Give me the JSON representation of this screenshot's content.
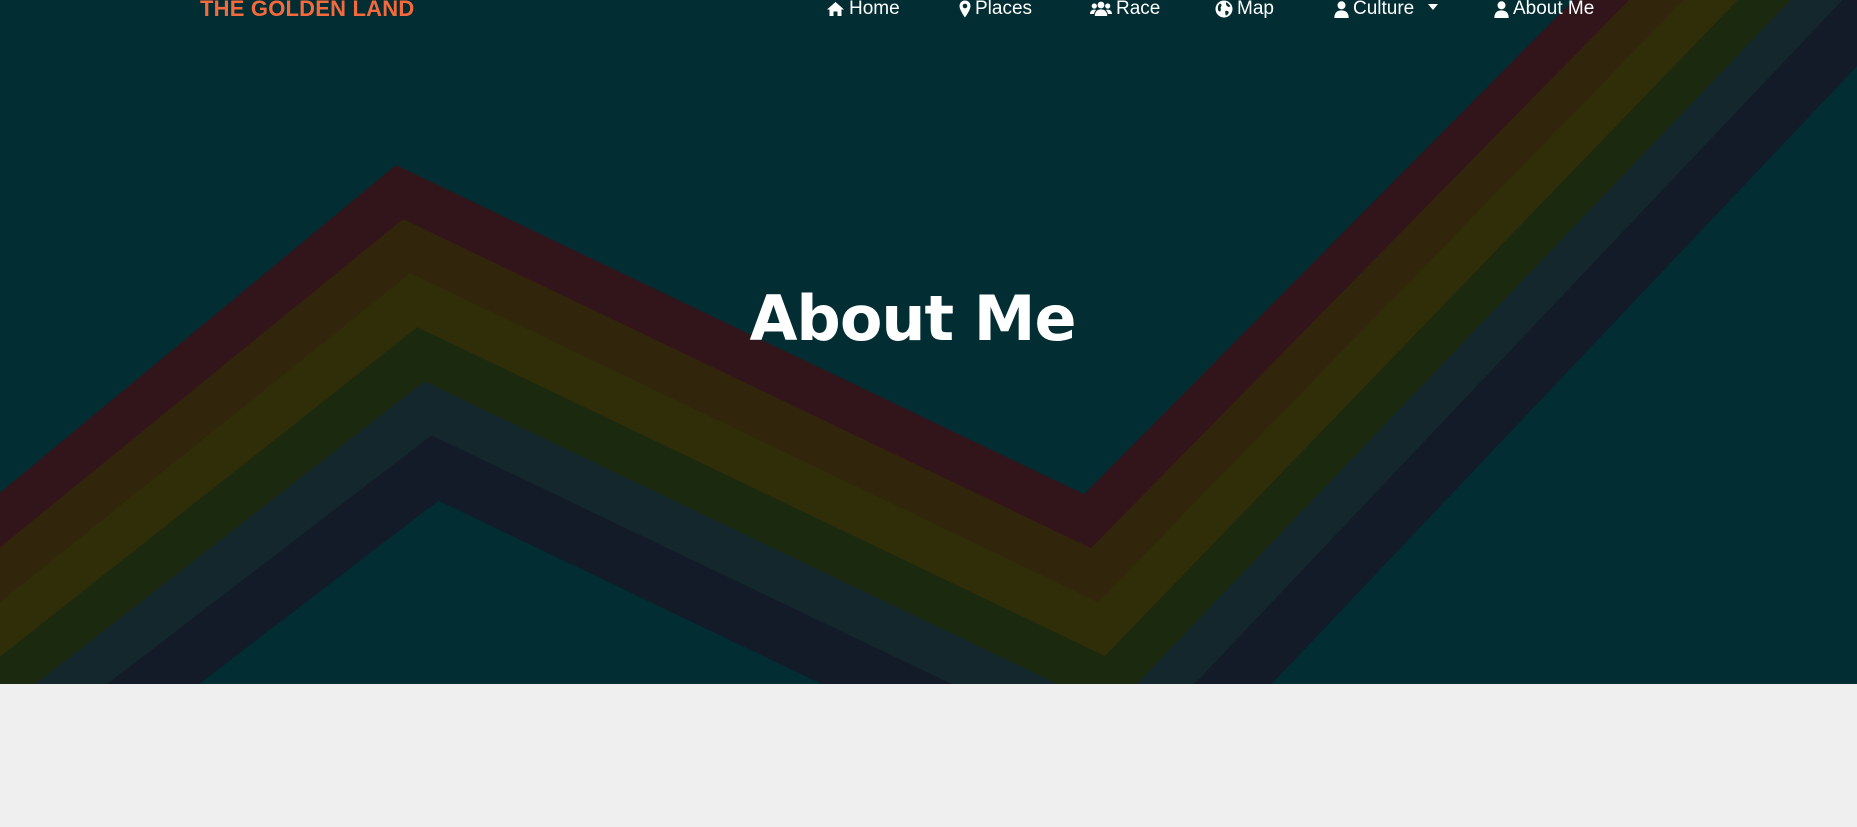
{
  "brand": "THE GOLDEN LAND",
  "nav": {
    "home": "Home",
    "places": "Places",
    "race": "Race",
    "map": "Map",
    "culture": "Culture",
    "about": "About Me"
  },
  "hero": {
    "title": "About Me"
  },
  "colors": {
    "hero_background": "#012d33",
    "page_background": "#efefef",
    "brand": "#f26a3d",
    "nav_text": "#ffffff",
    "stripes": [
      "#32151a",
      "#31250b",
      "#302e08",
      "#1b290f",
      "#13272c",
      "#121b27"
    ]
  },
  "icons": {
    "home": "home-icon",
    "places": "map-marker-icon",
    "race": "users-icon",
    "map": "globe-icon",
    "culture": "user-icon",
    "about": "user-icon"
  }
}
